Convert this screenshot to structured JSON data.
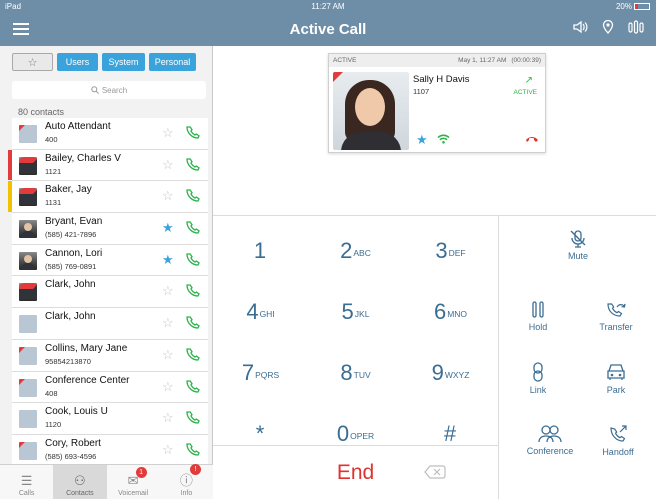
{
  "status": {
    "left": "iPad",
    "time": "11:27 AM",
    "battery": "20%"
  },
  "nav": {
    "title": "Active Call"
  },
  "filters": {
    "users": "Users",
    "system": "System",
    "personal": "Personal"
  },
  "search": {
    "placeholder": "Search"
  },
  "contacts_count": "80 contacts",
  "contacts": [
    {
      "name": "Auto Attendant",
      "sub": "400",
      "fav": false,
      "flag": ""
    },
    {
      "name": "Bailey, Charles V",
      "sub": "1121",
      "fav": false,
      "flag": "#e23b3b"
    },
    {
      "name": "Baker, Jay",
      "sub": "1131",
      "fav": false,
      "flag": "#f2c200"
    },
    {
      "name": "Bryant, Evan",
      "sub": "(585) 421-7896",
      "fav": true,
      "flag": ""
    },
    {
      "name": "Cannon, Lori",
      "sub": "(585) 769-0891",
      "fav": true,
      "flag": ""
    },
    {
      "name": "Clark, John",
      "sub": "",
      "fav": false,
      "flag": ""
    },
    {
      "name": "Clark, John",
      "sub": "",
      "fav": false,
      "flag": ""
    },
    {
      "name": "Collins, Mary Jane",
      "sub": "95854213870",
      "fav": false,
      "flag": ""
    },
    {
      "name": "Conference Center",
      "sub": "408",
      "fav": false,
      "flag": ""
    },
    {
      "name": "Cook, Louis U",
      "sub": "1120",
      "fav": false,
      "flag": ""
    },
    {
      "name": "Cory, Robert",
      "sub": "(585) 693-4596",
      "fav": false,
      "flag": ""
    }
  ],
  "tabs": [
    {
      "label": "Calls",
      "icon": "list-icon",
      "badge": ""
    },
    {
      "label": "Contacts",
      "icon": "person-icon",
      "badge": ""
    },
    {
      "label": "Voicemail",
      "icon": "envelope-icon",
      "badge": "1"
    },
    {
      "label": "Info",
      "icon": "info-icon",
      "badge": "!"
    }
  ],
  "call": {
    "state": "ACTIVE",
    "datetime": "May 1, 11:27 AM",
    "duration": "(00:00:39)",
    "name": "Sally H Davis",
    "ext": "1107",
    "status": "ACTIVE"
  },
  "keys": [
    {
      "d": "1",
      "s": ""
    },
    {
      "d": "2",
      "s": "ABC"
    },
    {
      "d": "3",
      "s": "DEF"
    },
    {
      "d": "4",
      "s": "GHI"
    },
    {
      "d": "5",
      "s": "JKL"
    },
    {
      "d": "6",
      "s": "MNO"
    },
    {
      "d": "7",
      "s": "PQRS"
    },
    {
      "d": "8",
      "s": "TUV"
    },
    {
      "d": "9",
      "s": "WXYZ"
    },
    {
      "d": "*",
      "s": ""
    },
    {
      "d": "0",
      "s": "OPER"
    },
    {
      "d": "#",
      "s": ""
    }
  ],
  "end_label": "End",
  "actions": {
    "mute": "Mute",
    "hold": "Hold",
    "transfer": "Transfer",
    "link": "Link",
    "park": "Park",
    "conference": "Conference",
    "handoff": "Handoff"
  },
  "colors": {
    "accent": "#3aa3dc",
    "nav": "#6e8ea8",
    "green": "#2cb34a",
    "red": "#e0332f",
    "key": "#3b6d93"
  }
}
